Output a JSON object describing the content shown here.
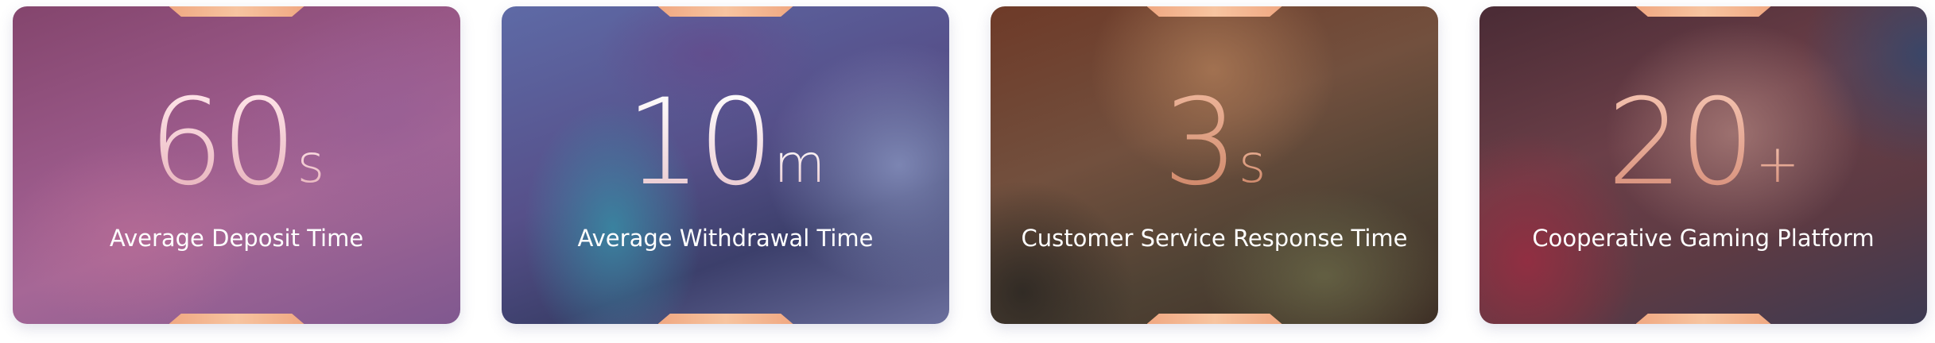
{
  "stats": [
    {
      "value": "60",
      "unit": "s",
      "label": "Average Deposit Time"
    },
    {
      "value": "10",
      "unit": "m",
      "label": "Average Withdrawal Time"
    },
    {
      "value": "3",
      "unit": "s",
      "label": "Customer Service Response Time"
    },
    {
      "value": "20",
      "unit": "+",
      "label": "Cooperative Gaming Platform"
    }
  ],
  "colors": {
    "tab_accent": "#f0a882",
    "label_text": "#ffffff"
  }
}
